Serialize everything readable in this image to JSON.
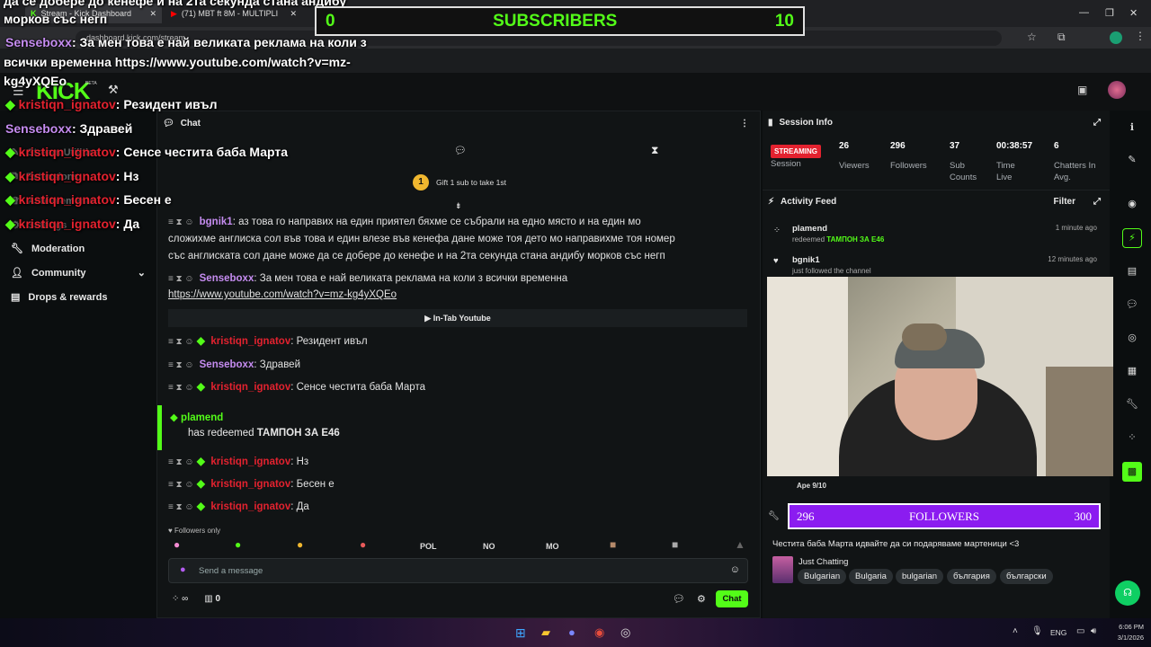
{
  "browser": {
    "tabs": [
      {
        "label": "Stream - Kick Dashboard"
      },
      {
        "label": "(71) МВТ ft 8М - MULTIPLI"
      }
    ],
    "url": "dashboard.kick.com/stream"
  },
  "overlay": {
    "subscribers": {
      "left": "0",
      "label": "SUBSCRIBERS",
      "right": "10"
    },
    "lines": [
      {
        "user": "",
        "text": "да се добере до кенефе и на 2та секунда стана андибу",
        "color": "white"
      },
      {
        "user": "",
        "text": "морков със негп",
        "color": "white"
      },
      {
        "user": "Senseboxx",
        "text": ": За мен това е най великата реклама на коли з",
        "color": "purple"
      },
      {
        "user": "",
        "text": "всички временна https://www.youtube.com/watch?v=mz-",
        "color": "white"
      },
      {
        "user": "",
        "text": "kg4yXQEo",
        "color": "white"
      },
      {
        "user": "kristiqn_ignatov",
        "text": ": Резидент ивъл",
        "color": "red"
      },
      {
        "user": "Senseboxx",
        "text": ": Здравей",
        "color": "purple"
      },
      {
        "user": "kristiqn_ignatov",
        "text": ": Сенсе честита баба Марта",
        "color": "red"
      },
      {
        "user": "kristiqn_ignatov",
        "text": ": Нз",
        "color": "red"
      },
      {
        "user": "kristiqn_ignatov",
        "text": ": Бесен е",
        "color": "red"
      },
      {
        "user": "kristiqn_ignatov",
        "text": ": Да",
        "color": "red"
      }
    ]
  },
  "kick": {
    "logo": "KICK",
    "beta": "BETA"
  },
  "sidebar": {
    "items": [
      {
        "label": "Stream Utilities",
        "icon": "tool-icon"
      },
      {
        "label": "Extensions",
        "icon": "puzzle-icon"
      },
      {
        "label": "Achievements",
        "icon": "trophy-icon"
      },
      {
        "label": "Settings",
        "icon": "gear-icon"
      },
      {
        "label": "Moderation",
        "icon": "wrench-icon"
      },
      {
        "label": "Community",
        "icon": "people-icon"
      },
      {
        "label": "Drops & rewards",
        "icon": "gift-icon"
      }
    ]
  },
  "chat": {
    "title": "Chat",
    "gift_text": "Gift 1 sub to take 1st",
    "gift_badge": "1",
    "messages": [
      {
        "user": "bgnik1",
        "text": ": аз това го направих на един приятел бяхме се събрали на едно място и на един мо",
        "color": "p"
      },
      {
        "user": "",
        "text": "сложихме англиска сол във това и един влезе във кенефа дане може тоя дето мо направихме тоя номер",
        "color": ""
      },
      {
        "user": "",
        "text": "със англиската сол дане може да се добере до кенефе и на 2та секунда стана андибу морков със негп",
        "color": ""
      },
      {
        "user": "Senseboxx",
        "text": ": За мен това е най великата реклама на коли з всички временна",
        "color": "p"
      },
      {
        "user": "",
        "text": "https://www.youtube.com/watch?v=mz-kg4yXQEo",
        "color": ""
      },
      {
        "user": "kristiqn_ignatov",
        "text": ": Резидент ивъл",
        "color": "red"
      },
      {
        "user": "Senseboxx",
        "text": ": Здравей",
        "color": "p"
      },
      {
        "user": "kristiqn_ignatov",
        "text": ": Сенсе честита баба Марта",
        "color": "red"
      },
      {
        "user": "kristiqn_ignatov",
        "text": ": Нз",
        "color": "red"
      },
      {
        "user": "kristiqn_ignatov",
        "text": ": Бесен е",
        "color": "red"
      },
      {
        "user": "kristiqn_ignatov",
        "text": ": Да",
        "color": "red"
      }
    ],
    "intab_label": "In-Tab Youtube",
    "redeem": {
      "user": "plamend",
      "text": "has redeemed ",
      "item": "ТАМПОН ЗА Е46"
    },
    "followers_only": "Followers only",
    "emotes": [
      "POL",
      "NO",
      "MO"
    ],
    "placeholder": "Send a message",
    "footer_count": "0",
    "send_label": "Chat"
  },
  "session": {
    "title": "Session Info",
    "status": "STREAMING",
    "stats": [
      {
        "value": "",
        "label": "Session"
      },
      {
        "value": "26",
        "label": "Viewers"
      },
      {
        "value": "296",
        "label": "Followers"
      },
      {
        "value": "37",
        "label": "Sub Counts"
      },
      {
        "value": "00:38:57",
        "label": "Time Live"
      },
      {
        "value": "6",
        "label": "Chatters In Avg."
      }
    ]
  },
  "activity": {
    "title": "Activity Feed",
    "filter_label": "Filter",
    "items": [
      {
        "user": "plamend",
        "action": "redeemed ",
        "item": "ТАМПОН ЗА Е46",
        "time": "1 minute ago"
      },
      {
        "user": "bgnik1",
        "action": "just followed the channel",
        "item": "",
        "time": "12 minutes ago"
      }
    ]
  },
  "stream_info": {
    "date_label": "Ape 9/10",
    "followers_goal": {
      "current": "296",
      "label": "FOLLOWERS",
      "target": "300"
    },
    "title": "Честита баба Марта идвайте да си подаряваме мартеници <3",
    "category": "Just Chatting",
    "tags": [
      "Bulgarian",
      "Bulgaria",
      "bulgarian",
      "българия",
      "български"
    ]
  },
  "taskbar": {
    "lang": "ENG",
    "time": "6:06 PM",
    "date": "3/1/2026"
  },
  "colors": {
    "kick_green": "#53fc18",
    "purple": "#8b1cf0",
    "red_user": "#e3222f",
    "purple_user": "#c58cf0"
  }
}
